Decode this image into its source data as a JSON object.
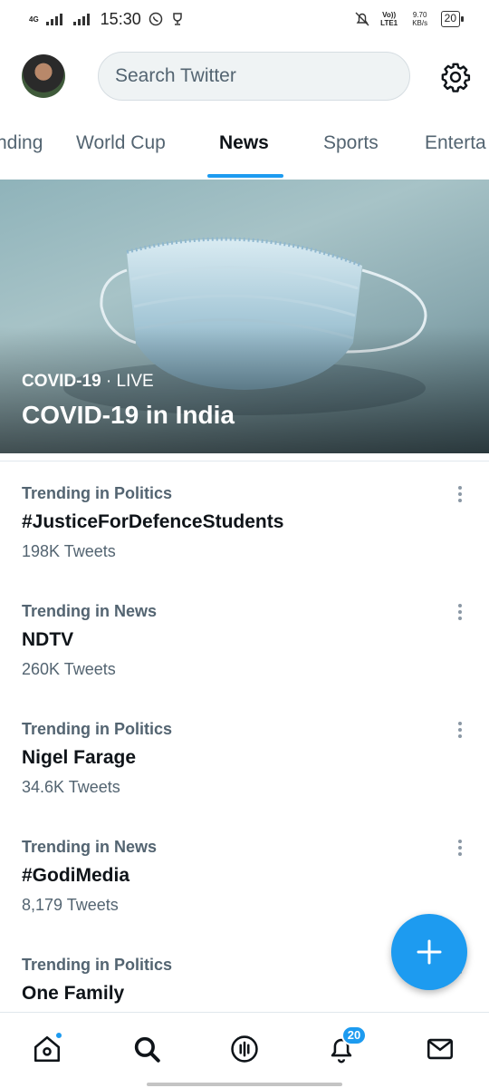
{
  "status_bar": {
    "network_left": "4G",
    "time": "15:30",
    "volte": "Vo)) LTE1",
    "speed": "9.70 KB/s",
    "battery": "20"
  },
  "header": {
    "search_placeholder": "Search Twitter",
    "avatar_icon": "user-avatar",
    "settings_icon": "gear-icon"
  },
  "tabs": [
    {
      "label": "nding",
      "active": false
    },
    {
      "label": "World Cup",
      "active": false
    },
    {
      "label": "News",
      "active": true
    },
    {
      "label": "Sports",
      "active": false
    },
    {
      "label": "Enterta",
      "active": false
    }
  ],
  "hero": {
    "category": "COVID-19",
    "separator": " · ",
    "status": "LIVE",
    "title": "COVID-19 in India"
  },
  "trends": [
    {
      "category": "Trending in Politics",
      "name": "#JusticeForDefenceStudents",
      "count": "198K Tweets"
    },
    {
      "category": "Trending in News",
      "name": "NDTV",
      "count": "260K Tweets"
    },
    {
      "category": "Trending in Politics",
      "name": "Nigel Farage",
      "count": "34.6K Tweets"
    },
    {
      "category": "Trending in News",
      "name": "#GodiMedia",
      "count": "8,179 Tweets"
    },
    {
      "category": "Trending in Politics",
      "name": "One Family",
      "count": ""
    }
  ],
  "bottom_nav": {
    "items": [
      "home-icon",
      "search-icon",
      "spaces-icon",
      "bell-icon",
      "mail-icon"
    ],
    "notification_badge": "20"
  },
  "colors": {
    "accent": "#1d9bf0",
    "secondary_text": "#536471",
    "primary_text": "#0f1419"
  }
}
